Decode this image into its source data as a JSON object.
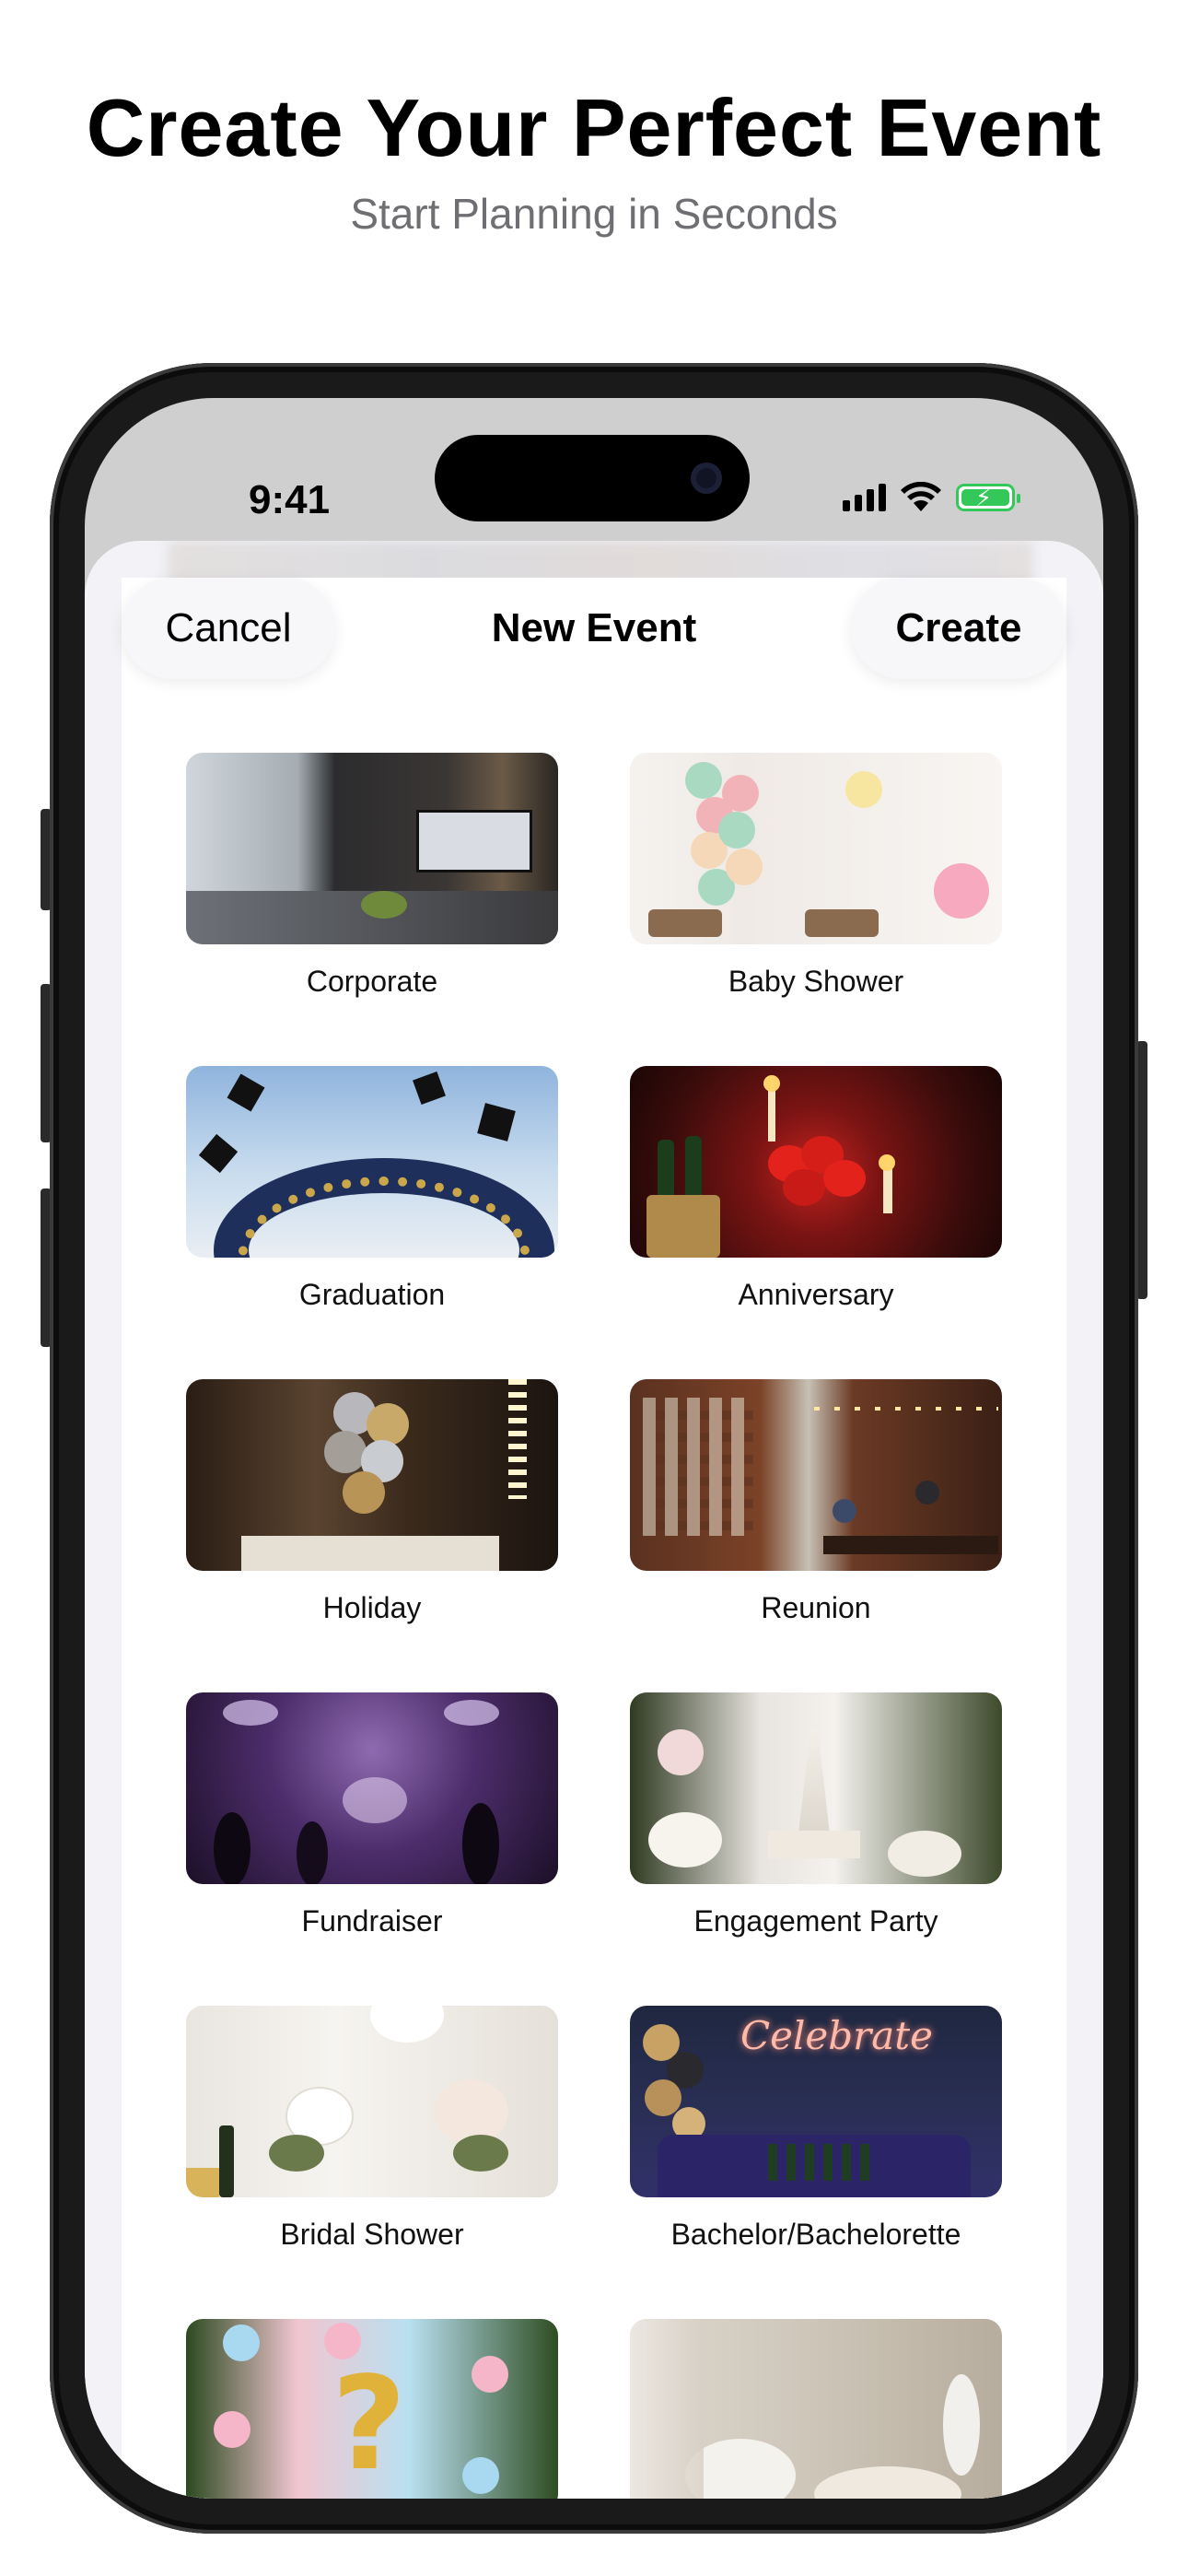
{
  "promo": {
    "headline": "Create Your Perfect Event",
    "subheadline": "Start Planning in Seconds"
  },
  "status_bar": {
    "time": "9:41",
    "icons": [
      "signal-icon",
      "wifi-icon",
      "battery-charging-icon"
    ]
  },
  "nav": {
    "cancel_label": "Cancel",
    "title": "New Event",
    "create_label": "Create"
  },
  "event_types": [
    {
      "label": "Corporate"
    },
    {
      "label": "Baby Shower"
    },
    {
      "label": "Graduation"
    },
    {
      "label": "Anniversary"
    },
    {
      "label": "Holiday"
    },
    {
      "label": "Reunion"
    },
    {
      "label": "Fundraiser"
    },
    {
      "label": "Engagement Party"
    },
    {
      "label": "Bridal Shower"
    },
    {
      "label": "Bachelor/Bachelorette"
    },
    {
      "label": ""
    },
    {
      "label": ""
    }
  ],
  "colors": {
    "battery": "#34c759",
    "sheet_background": "#f2f2f7"
  }
}
